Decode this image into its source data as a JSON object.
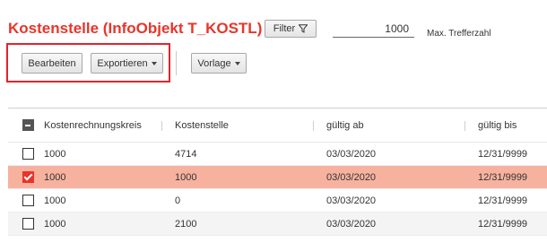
{
  "page": {
    "title": "Kostenstelle (InfoObjekt T_KOSTL)"
  },
  "toolbar": {
    "filter_label": "Filter",
    "max_hits_value": "1000",
    "max_hits_label": "Max. Trefferzahl",
    "edit_label": "Bearbeiten",
    "export_label": "Exportieren",
    "template_label": "Vorlage"
  },
  "table": {
    "columns": [
      "Kostenrechnungskreis",
      "Kostenstelle",
      "gültig ab",
      "gültig bis"
    ],
    "rows": [
      {
        "selected": false,
        "cells": [
          "1000",
          "4714",
          "03/03/2020",
          "12/31/9999"
        ]
      },
      {
        "selected": true,
        "cells": [
          "1000",
          "1000",
          "03/03/2020",
          "12/31/9999"
        ]
      },
      {
        "selected": false,
        "cells": [
          "1000",
          "0",
          "03/03/2020",
          "12/31/9999"
        ]
      },
      {
        "selected": false,
        "cells": [
          "1000",
          "2100",
          "03/03/2020",
          "12/31/9999"
        ]
      }
    ]
  },
  "colors": {
    "accent": "#e8352a",
    "selected_row": "#f7b29f",
    "highlight_border": "#e3232b"
  },
  "icons": {
    "filter": "funnel-icon",
    "dropdown": "chevron-down-icon"
  }
}
